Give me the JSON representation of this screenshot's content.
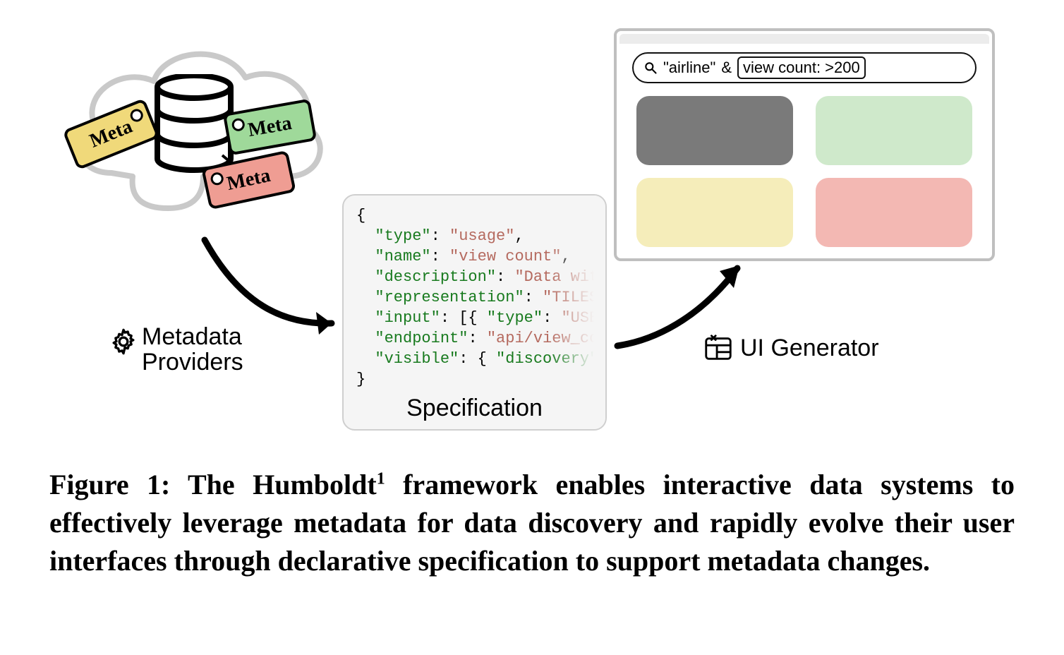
{
  "labels": {
    "providers_line1": "Metadata",
    "providers_line2": "Providers",
    "specification": "Specification",
    "ui_generator": "UI Generator"
  },
  "tags": {
    "yellow": "Meta",
    "green": "Meta",
    "red": "Meta"
  },
  "search": {
    "quoted_term": "\"airline\"",
    "and_symbol": "&",
    "chip_text": "view count: >200"
  },
  "tiles": [
    "gray",
    "green",
    "yellow",
    "red"
  ],
  "spec": {
    "k_type": "\"type\"",
    "v_type": "\"usage\"",
    "k_name": "\"name\"",
    "v_name": "\"view count\"",
    "k_description": "\"description\"",
    "v_description": "\"Data wit",
    "k_representation": "\"representation\"",
    "v_representation": "\"TILES",
    "k_input": "\"input\"",
    "v_input_type_key": "\"type\"",
    "v_input_type_val": "\"USE",
    "k_endpoint": "\"endpoint\"",
    "v_endpoint": "\"api/view_co",
    "k_visible": "\"visible\"",
    "v_visible_key": "\"discovery\""
  },
  "caption": {
    "prefix": "Figure 1: The Humboldt",
    "sup": "1",
    "rest": " framework enables interactive data systems to effectively leverage metadata for data discovery and rapidly evolve their user interfaces through declarative specification to support metadata changes."
  }
}
